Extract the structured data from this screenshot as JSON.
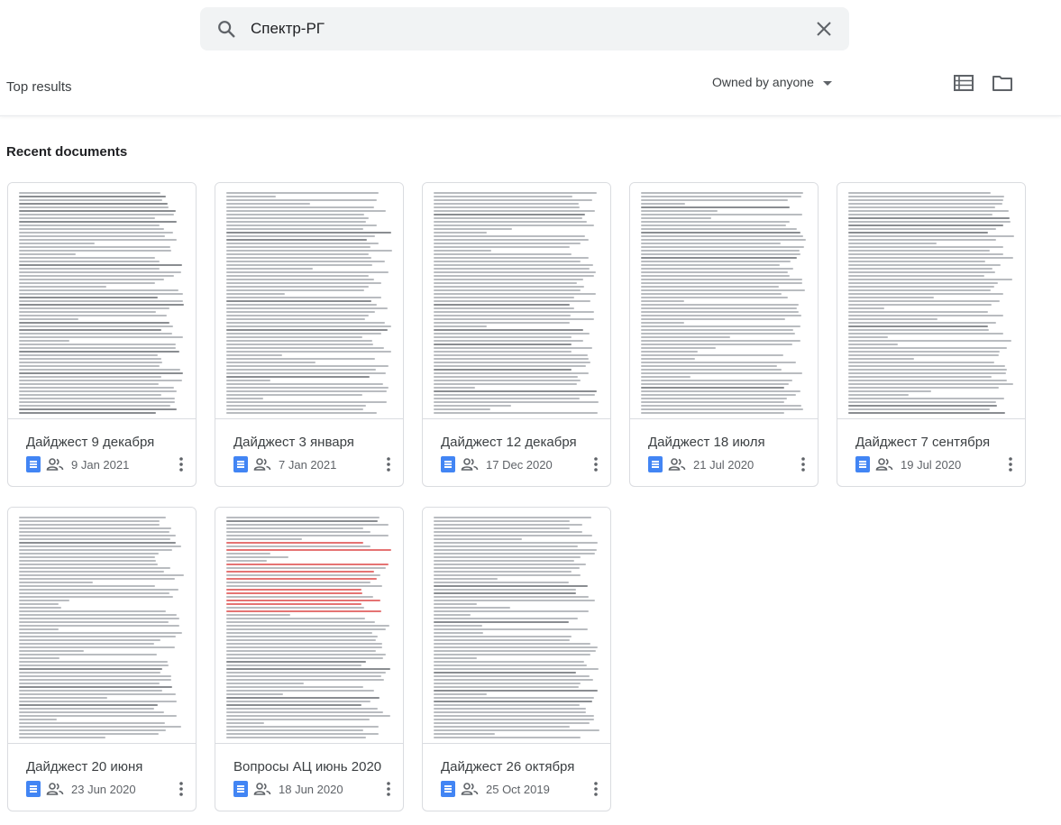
{
  "search": {
    "query": "Спектр-РГ"
  },
  "filters": {
    "top_results_label": "Top results",
    "owner_label": "Owned by anyone"
  },
  "section": {
    "recent_label": "Recent documents"
  },
  "cards": [
    {
      "title": "Дайджест 9 декабря",
      "date": "9 Jan 2021",
      "type": "doc"
    },
    {
      "title": "Дайджест 3 января",
      "date": "7 Jan 2021",
      "type": "doc"
    },
    {
      "title": "Дайджест 12 декабря",
      "date": "17 Dec 2020",
      "type": "doc"
    },
    {
      "title": "Дайджест 18 июля",
      "date": "21 Jul 2020",
      "type": "doc"
    },
    {
      "title": "Дайджест 7 сентября",
      "date": "19 Jul 2020",
      "type": "doc"
    },
    {
      "title": "Дайджест 20 июня",
      "date": "23 Jun 2020",
      "type": "doc"
    },
    {
      "title": "Вопросы АЦ июнь 2020",
      "date": "18 Jun 2020",
      "type": "doc"
    },
    {
      "title": "Дайджест 26 октября",
      "date": "25 Oct 2019",
      "type": "doc"
    }
  ],
  "icons": {
    "search": "search-icon",
    "clear": "close-icon",
    "list_view": "list-view-icon",
    "folder": "folder-icon",
    "doc": "google-docs-icon",
    "shared": "people-icon",
    "more": "more-vert-icon"
  },
  "colors": {
    "docs_blue": "#4285f4",
    "search_bg": "#f1f3f4"
  }
}
